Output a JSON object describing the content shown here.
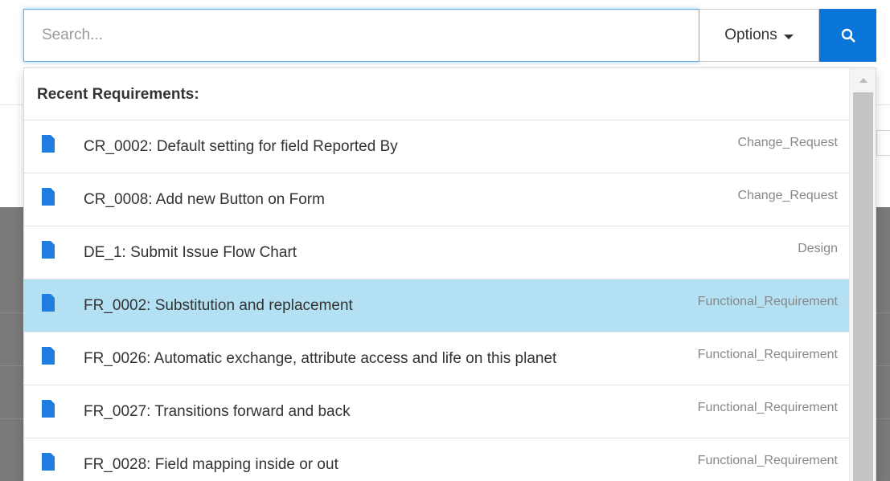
{
  "search": {
    "placeholder": "Search...",
    "value": ""
  },
  "options_button": {
    "label": "Options",
    "icon": "caret-down-icon"
  },
  "search_button": {
    "icon": "search-icon",
    "color": "#0a75d8"
  },
  "dropdown": {
    "header": "Recent Requirements:",
    "items": [
      {
        "title": "CR_0002: Default setting for field Reported By",
        "type": "Change_Request",
        "icon": "document-icon",
        "active": false
      },
      {
        "title": "CR_0008: Add new Button on Form",
        "type": "Change_Request",
        "icon": "document-icon",
        "active": false
      },
      {
        "title": "DE_1: Submit Issue Flow Chart",
        "type": "Design",
        "icon": "document-icon",
        "active": false
      },
      {
        "title": "FR_0002: Substitution and replacement",
        "type": "Functional_Requirement",
        "icon": "document-icon",
        "active": true
      },
      {
        "title": "FR_0026: Automatic exchange, attribute access and life on this planet",
        "type": "Functional_Requirement",
        "icon": "document-icon",
        "active": false
      },
      {
        "title": "FR_0027: Transitions forward and back",
        "type": "Functional_Requirement",
        "icon": "document-icon",
        "active": false
      },
      {
        "title": "FR_0028: Field mapping inside or out",
        "type": "Functional_Requirement",
        "icon": "document-icon",
        "active": false
      }
    ]
  },
  "colors": {
    "accent": "#0a75d8",
    "active_row": "#b3e0f2",
    "document_icon": "#1f7de0"
  }
}
